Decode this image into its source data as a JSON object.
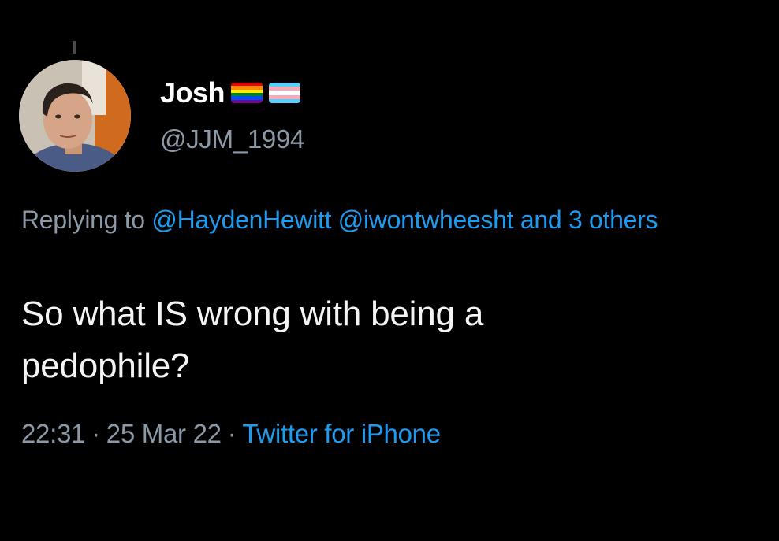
{
  "user": {
    "display_name": "Josh",
    "handle": "@JJM_1994",
    "flags": [
      "rainbow-pride-flag",
      "transgender-pride-flag"
    ]
  },
  "reply": {
    "prefix": "Replying to",
    "mentions": [
      "@HaydenHewitt",
      "@iwontwheesht"
    ],
    "suffix": "and 3 others"
  },
  "tweet": {
    "text_line1": "So what IS wrong with being a",
    "text_line2": "pedophile?"
  },
  "meta": {
    "time": "22:31",
    "date": "25 Mar 22",
    "separator": "·",
    "source": "Twitter for iPhone"
  },
  "colors": {
    "background": "#000000",
    "text": "#e7e9ea",
    "secondary_text": "#8b98a5",
    "link": "#1d9bf0"
  }
}
